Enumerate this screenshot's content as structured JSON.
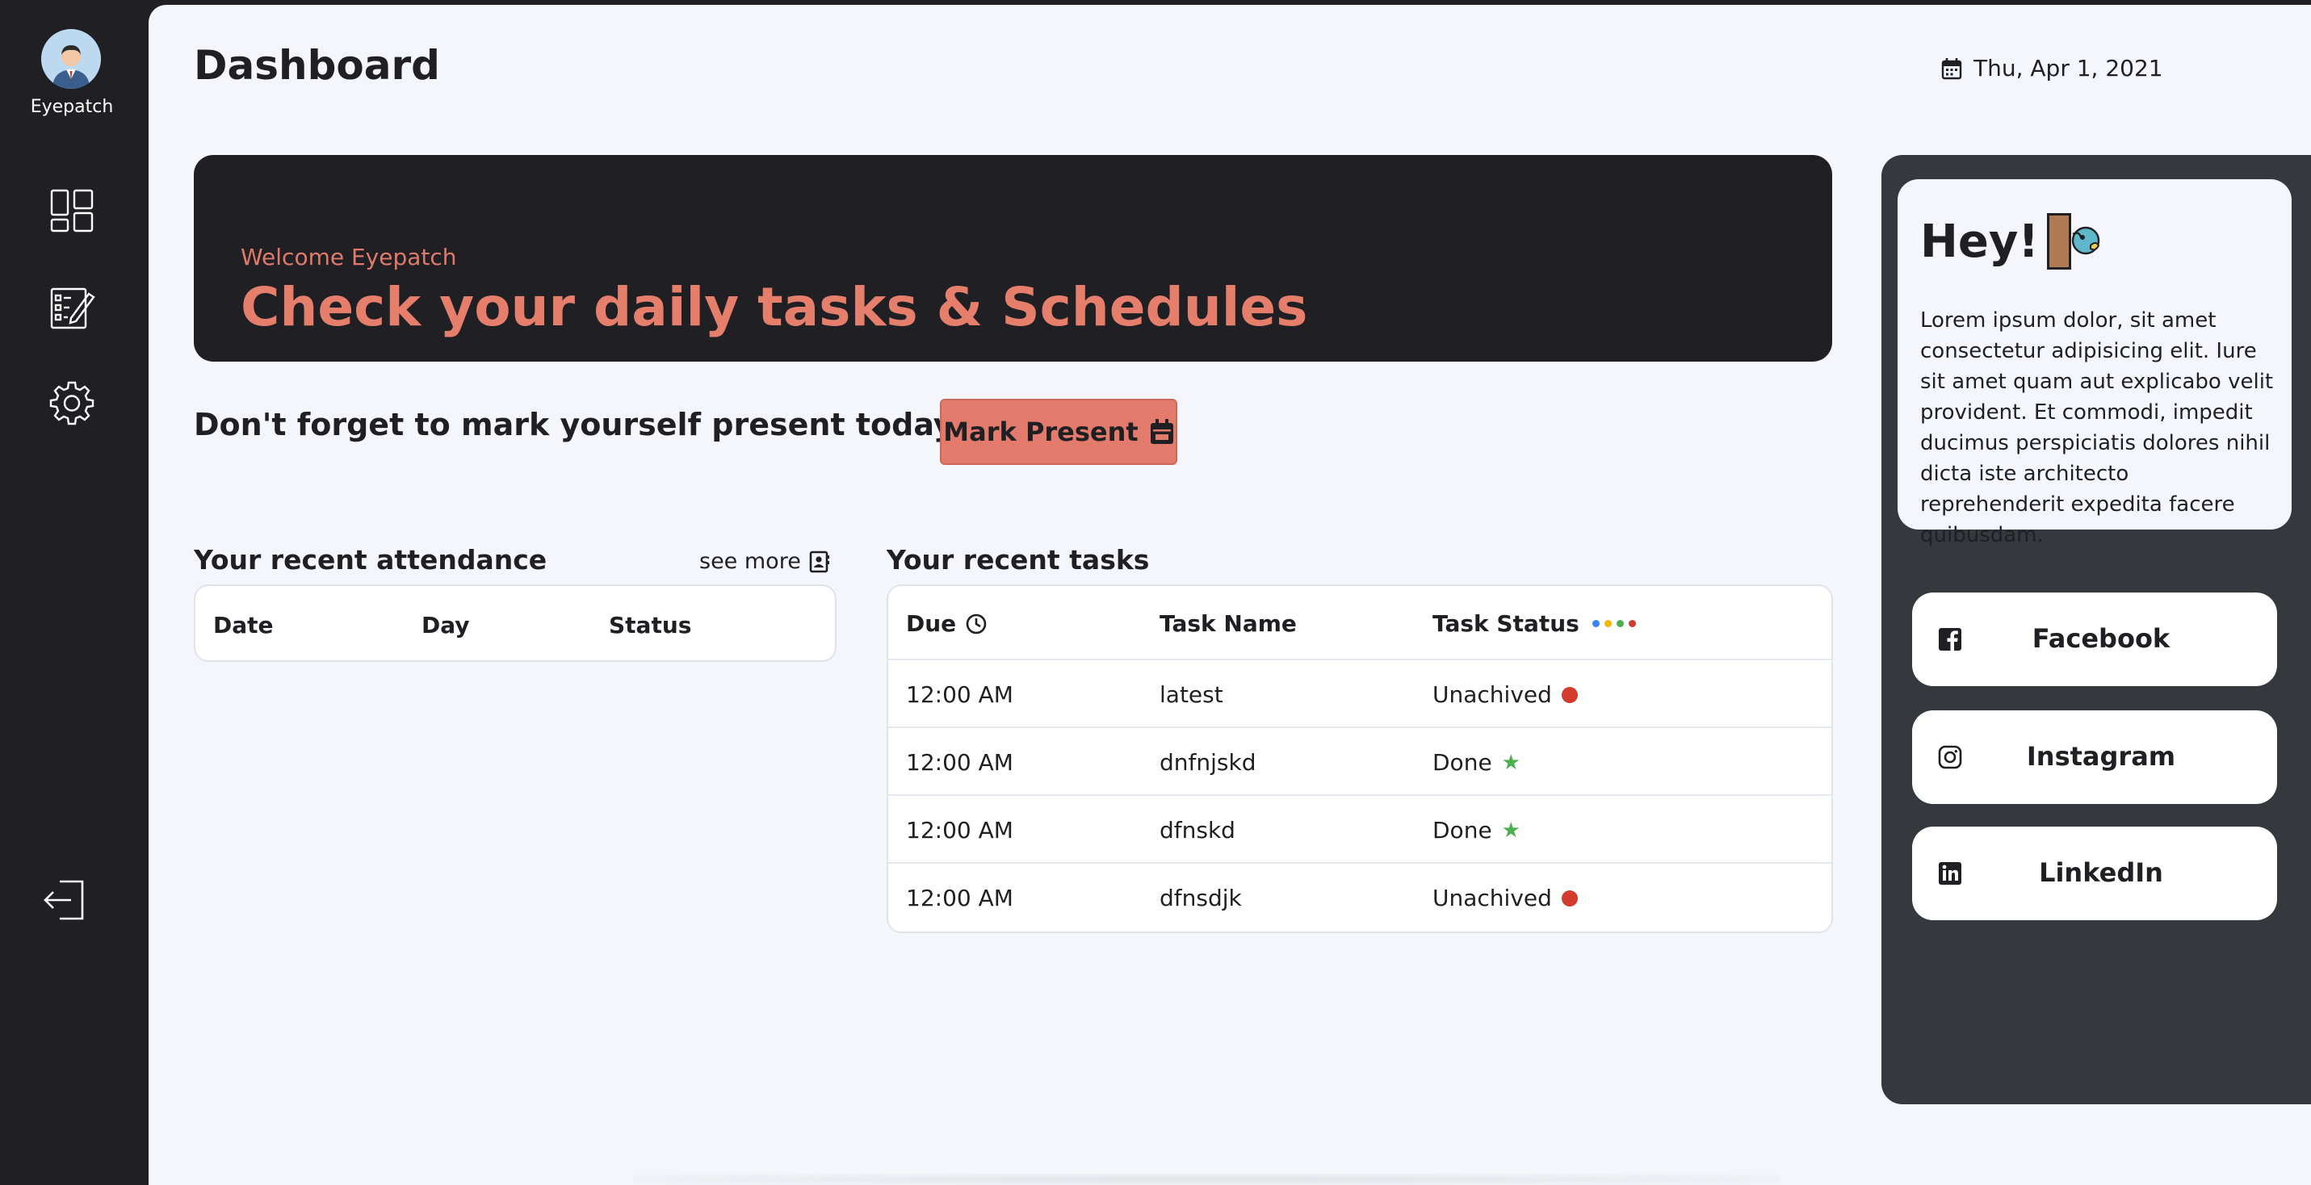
{
  "sidebar": {
    "user_name": "Eyepatch",
    "items": [
      {
        "name": "dashboard",
        "icon": "dashboard-icon"
      },
      {
        "name": "tasks",
        "icon": "edit-list-icon"
      },
      {
        "name": "settings",
        "icon": "gear-icon"
      }
    ],
    "logout_icon": "logout-icon"
  },
  "header": {
    "title": "Dashboard",
    "date": "Thu, Apr 1, 2021"
  },
  "banner": {
    "welcome": "Welcome Eyepatch",
    "title": "Check your daily tasks & Schedules"
  },
  "reminder": {
    "text": "Don't forget to mark yourself present today",
    "button_label": "Mark Present"
  },
  "attendance": {
    "title": "Your recent attendance",
    "see_more": "see more",
    "columns": [
      "Date",
      "Day",
      "Status"
    ]
  },
  "tasks": {
    "title": "Your recent tasks",
    "columns": [
      "Due",
      "Task Name",
      "Task Status"
    ],
    "status_dot_colors": [
      "#3b82f6",
      "#f5b800",
      "#4caf50",
      "#d23b2e"
    ],
    "rows": [
      {
        "due": "12:00 AM",
        "name": "latest",
        "status": "Unachived",
        "indicator": "red-dot"
      },
      {
        "due": "12:00 AM",
        "name": "dnfnjskd",
        "status": "Done",
        "indicator": "green-star"
      },
      {
        "due": "12:00 AM",
        "name": "dfnskd",
        "status": "Done",
        "indicator": "green-star"
      },
      {
        "due": "12:00 AM",
        "name": "dfnsdjk",
        "status": "Unachived",
        "indicator": "red-dot"
      }
    ]
  },
  "right_panel": {
    "hey_title": "Hey!",
    "hey_text": "Lorem ipsum dolor, sit amet consectetur adipisicing elit. Iure sit amet quam aut explicabo velit provident. Et commodi, impedit ducimus perspiciatis dolores nihil dicta iste architecto reprehenderit expedita facere quibusdam.",
    "socials": [
      {
        "label": "Facebook",
        "icon": "facebook-icon"
      },
      {
        "label": "Instagram",
        "icon": "instagram-icon"
      },
      {
        "label": "LinkedIn",
        "icon": "linkedin-icon"
      }
    ]
  },
  "colors": {
    "accent": "#e37b6c",
    "dark": "#1f1f24",
    "panel": "#35383d",
    "background": "#f4f6fb"
  }
}
